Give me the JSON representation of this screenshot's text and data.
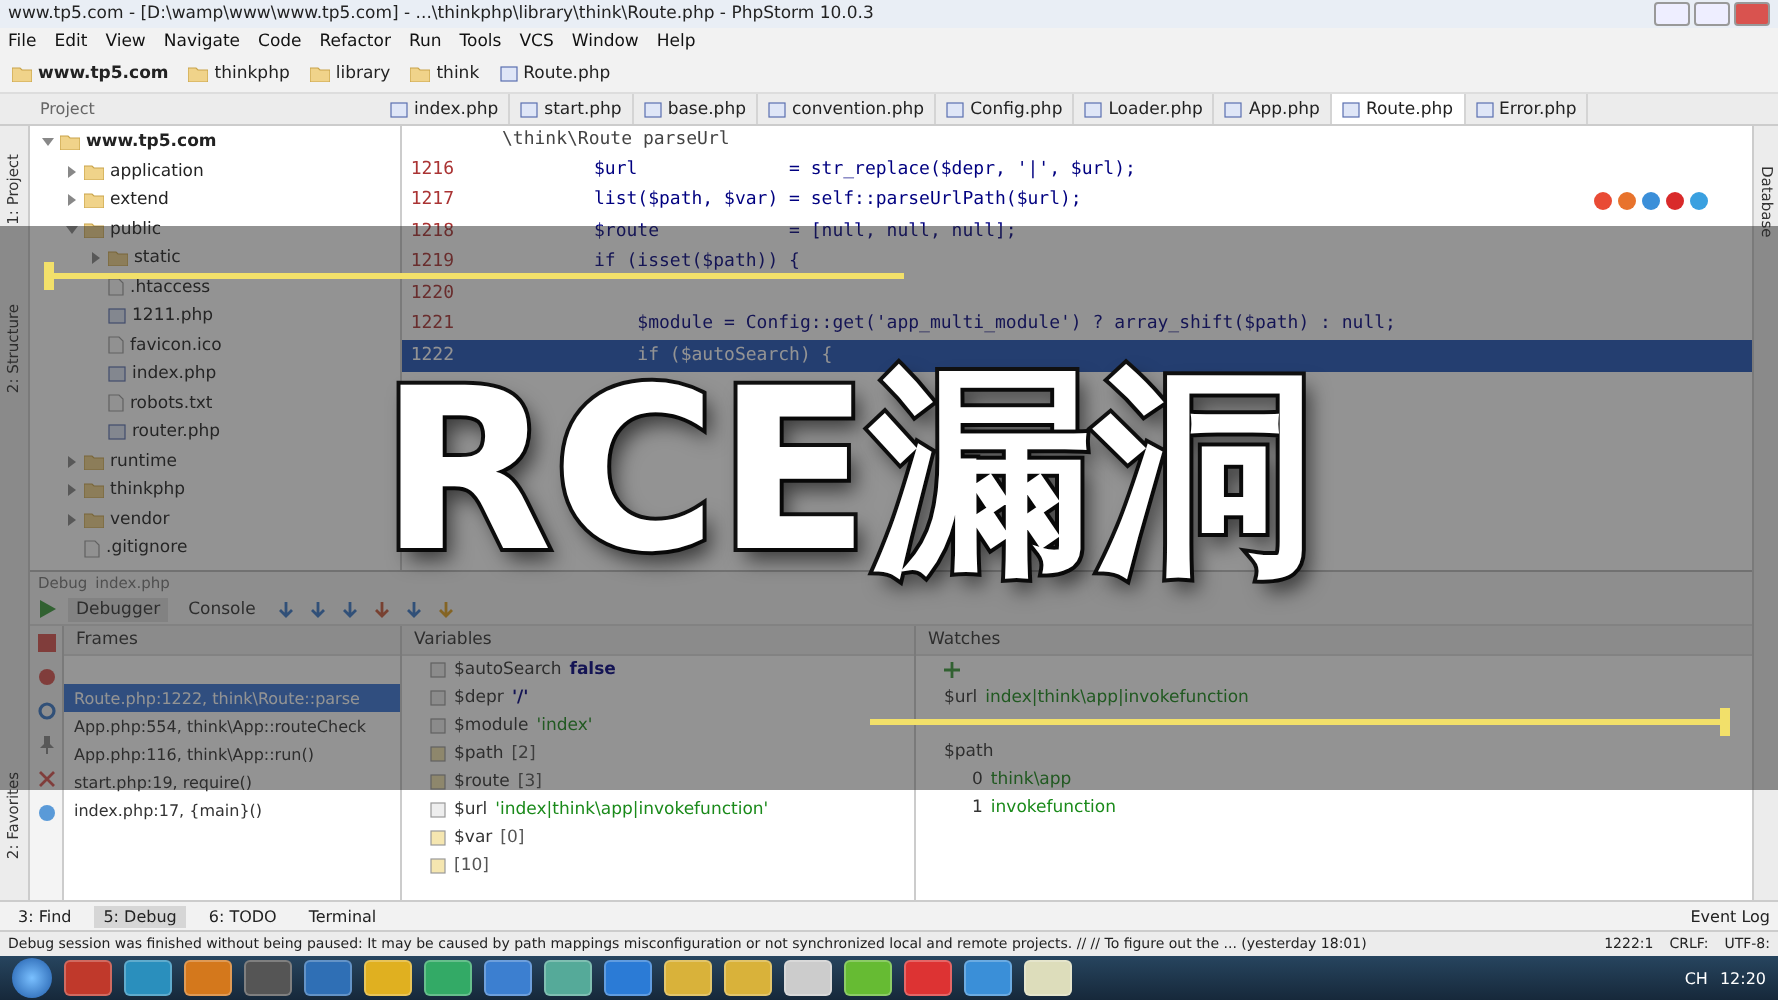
{
  "window": {
    "title": "www.tp5.com - [D:\\wamp\\www\\www.tp5.com] - ...\\thinkphp\\library\\think\\Route.php - PhpStorm 10.0.3"
  },
  "menu": [
    "File",
    "Edit",
    "View",
    "Navigate",
    "Code",
    "Refactor",
    "Run",
    "Tools",
    "VCS",
    "Window",
    "Help"
  ],
  "breadcrumb": [
    {
      "label": "www.tp5.com",
      "kind": "project"
    },
    {
      "label": "thinkphp",
      "kind": "folder"
    },
    {
      "label": "library",
      "kind": "folder"
    },
    {
      "label": "think",
      "kind": "folder"
    },
    {
      "label": "Route.php",
      "kind": "file"
    }
  ],
  "editor_tabs": [
    {
      "label": "index.php",
      "selected": false
    },
    {
      "label": "start.php",
      "selected": false
    },
    {
      "label": "base.php",
      "selected": false
    },
    {
      "label": "convention.php",
      "selected": false
    },
    {
      "label": "Config.php",
      "selected": false
    },
    {
      "label": "Loader.php",
      "selected": false
    },
    {
      "label": "App.php",
      "selected": false
    },
    {
      "label": "Route.php",
      "selected": true
    },
    {
      "label": "Error.php",
      "selected": false
    }
  ],
  "left_side_tabs": [
    "1: Project",
    "2: Structure"
  ],
  "bottom_side_tab": "2: Favorites",
  "right_side_tab": "Database",
  "project": {
    "label": "Project",
    "tree": [
      {
        "label": "www.tp5.com",
        "kind": "folder",
        "bold": true,
        "expanded": true,
        "children": [
          {
            "label": "application",
            "kind": "folder",
            "expanded": false
          },
          {
            "label": "extend",
            "kind": "folder",
            "expanded": false
          },
          {
            "label": "public",
            "kind": "folder",
            "expanded": true,
            "children": [
              {
                "label": "static",
                "kind": "folder",
                "expanded": false
              },
              {
                "label": ".htaccess",
                "kind": "file"
              },
              {
                "label": "1211.php",
                "kind": "php"
              },
              {
                "label": "favicon.ico",
                "kind": "file"
              },
              {
                "label": "index.php",
                "kind": "php"
              },
              {
                "label": "robots.txt",
                "kind": "file"
              },
              {
                "label": "router.php",
                "kind": "php"
              }
            ]
          },
          {
            "label": "runtime",
            "kind": "folder",
            "expanded": false
          },
          {
            "label": "thinkphp",
            "kind": "folder",
            "expanded": false
          },
          {
            "label": "vendor",
            "kind": "folder",
            "expanded": false
          },
          {
            "label": ".gitignore",
            "kind": "file"
          }
        ]
      }
    ]
  },
  "editor": {
    "header": "\\think\\Route  parseUrl",
    "lines": [
      {
        "number": "1216",
        "code": "$url              = str_replace($depr, '|', $url);",
        "highlighted": false
      },
      {
        "number": "1217",
        "code": "list($path, $var) = self::parseUrlPath($url);",
        "highlighted": false
      },
      {
        "number": "1218",
        "code": "$route            = [null, null, null];",
        "highlighted": false
      },
      {
        "number": "1219",
        "code": "if (isset($path)) {",
        "highlighted": false
      },
      {
        "number": "1220",
        "highlighted": false
      },
      {
        "number": "1221",
        "code": "    $module = Config::get('app_multi_module') ? array_shift($path) : null;",
        "highlighted": false
      },
      {
        "number": "1222",
        "code": "    if ($autoSearch) {",
        "highlighted": true
      }
    ]
  },
  "debug": {
    "title": "Debug",
    "config": "index.php",
    "tabs": [
      {
        "label": "Debugger",
        "selected": true
      },
      {
        "label": "Console",
        "selected": false
      }
    ],
    "frames": {
      "title": "Frames",
      "items": [
        {
          "label": "Route.php:1222, think\\Route::parse",
          "selected": true
        },
        {
          "label": "App.php:554, think\\App::routeCheck",
          "selected": false
        },
        {
          "label": "App.php:116, think\\App::run()",
          "selected": false
        },
        {
          "label": "start.php:19, require()",
          "selected": false
        },
        {
          "label": "index.php:17, {main}()",
          "selected": false
        }
      ]
    },
    "variables": {
      "title": "Variables",
      "items": [
        {
          "name": "$autoSearch",
          "value": "false",
          "kind": "scalar"
        },
        {
          "name": "$depr",
          "value": "'/'",
          "kind": "scalar"
        },
        {
          "name": "$module",
          "value": "'index'",
          "kind": "string"
        },
        {
          "name": "$path",
          "value": "[2]",
          "kind": "array"
        },
        {
          "name": "$route",
          "value": "[3]",
          "kind": "array"
        },
        {
          "name": "$url",
          "value": "'index|think\\app|invokefunction'",
          "kind": "string"
        },
        {
          "name": "$var",
          "value": "[0]",
          "kind": "array"
        },
        {
          "value": "[10]",
          "kind": "array"
        }
      ]
    },
    "watches": {
      "title": "Watches",
      "items": [
        {
          "name": "$url",
          "value": "index|think\\app|invokefunction"
        },
        {
          "name": "$path",
          "children": [
            {
              "name": "0",
              "value": "think\\app"
            },
            {
              "name": "1",
              "value": "invokefunction"
            }
          ]
        }
      ]
    }
  },
  "tool_tabs": [
    {
      "label": "3: Find",
      "selected": false
    },
    {
      "label": "5: Debug",
      "selected": true
    },
    {
      "label": "6: TODO",
      "selected": false
    },
    {
      "label": "Terminal",
      "selected": false
    }
  ],
  "event_log": "Event Log",
  "status": {
    "message": "Debug session was finished without being paused: It may be caused by path mappings misconfiguration or not synchronized local and remote projects. // // To figure out the ... (yesterday 18:01)",
    "position": "1222:1",
    "line_separator": "CRLF:",
    "encoding": "UTF-8:"
  },
  "taskbar": {
    "language": "CH",
    "time": "12:20"
  },
  "overlay": {
    "title": "RCE漏洞"
  }
}
